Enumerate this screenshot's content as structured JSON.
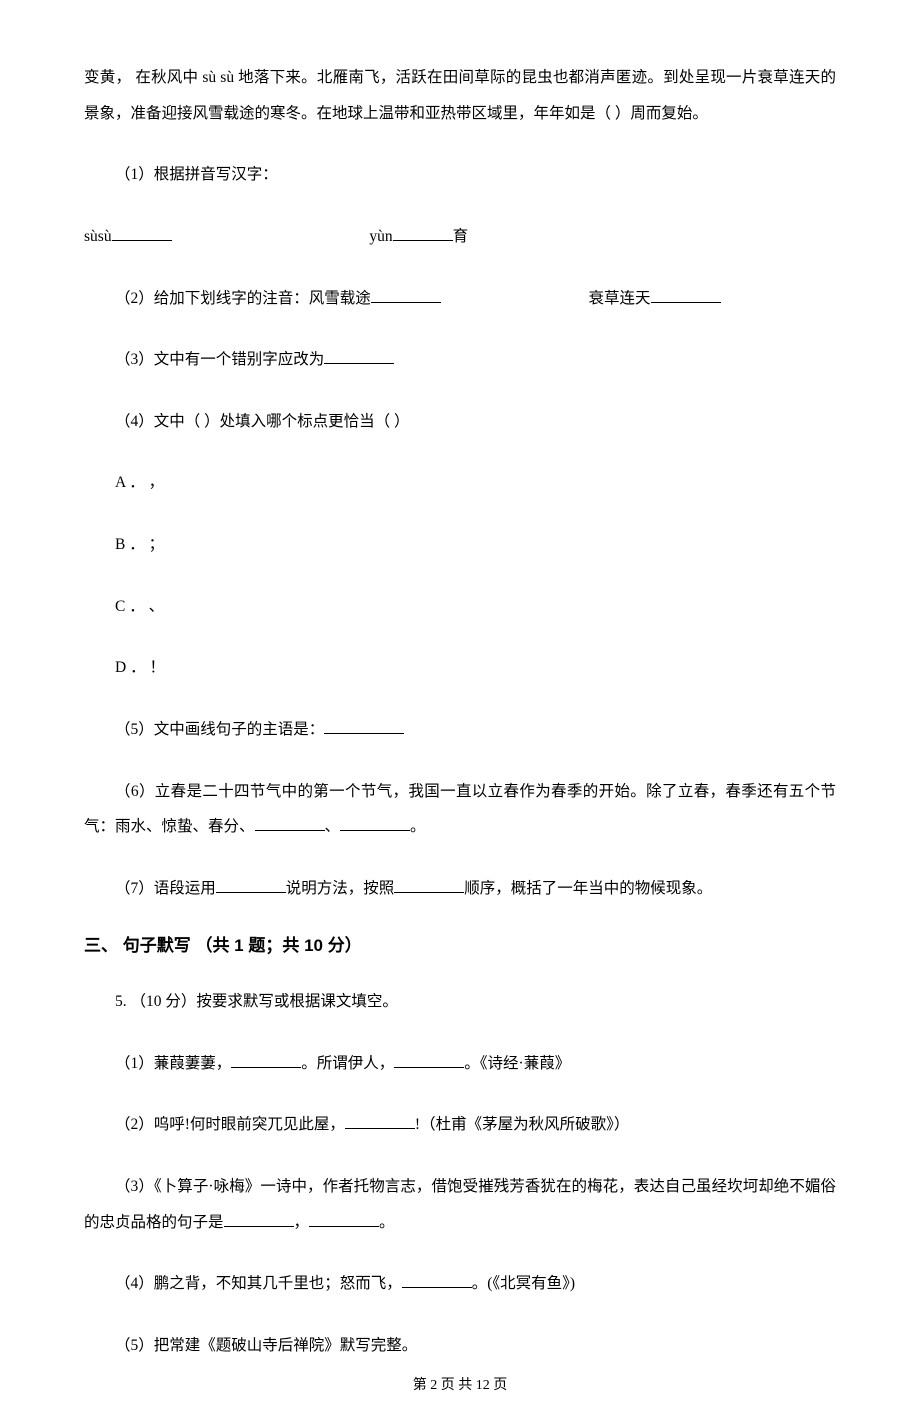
{
  "p1": "变黄，  在秋风中 sù   sù 地落下来。北雁南飞，活跃在田间草际的昆虫也都消声匿迹。到处呈现一片衰草连天的景象，准备迎接风雪载途的寒冬。在地球上温带和亚热带区域里，年年如是（     ）周而复始。",
  "q1": "（1）根据拼音写汉字：",
  "row_a": "   sùsù",
  "row_b": "yùn",
  "row_c": "育",
  "q2a": "（2）给加下划线字的注音：风雪载途",
  "q2b": "衰草连天",
  "q3": "（3）文中有一个错别字应改为",
  "q4": "（4）文中（     ）处填入哪个标点更恰当（     ）",
  "optA": "A ． ，",
  "optB": "B ． ；",
  "optC": "C ． 、",
  "optD": "D ． ！",
  "q5": "（5）文中画线句子的主语是：",
  "q6a": "（6）立春是二十四节气中的第一个节气，我国一直以立春作为春季的开始。除了立春，春季还有五个节气：雨水、惊蛰、春分、",
  "q6b": "、",
  "q6c": "。",
  "q7a": "（7）语段运用",
  "q7b": "说明方法，按照",
  "q7c": "顺序，概括了一年当中的物候现象。",
  "section3": "三、 句子默写 （共 1 题；共 10 分）",
  "q5header": "5.  （10 分）按要求默写或根据课文填空。",
  "s1a": "（1）蒹葭萋萋，",
  "s1b": "。所谓伊人，",
  "s1c": "。《诗经·蒹葭》",
  "s2a": "（2）呜呼!何时眼前突兀见此屋，",
  "s2b": "!（杜甫《茅屋为秋风所破歌》）",
  "s3a": "（3）《卜算子·咏梅》一诗中，作者托物言志，借饱受摧残芳香犹在的梅花，表达自己虽经坎坷却绝不媚俗的忠贞品格的句子是",
  "s3b": "，",
  "s3c": "。",
  "s4a": "（4）鹏之背，不知其几千里也；怒而飞，",
  "s4b": "。(《北冥有鱼》)",
  "s5": "（5）把常建《题破山寺后禅院》默写完整。",
  "footer": "第 2 页 共 12 页"
}
